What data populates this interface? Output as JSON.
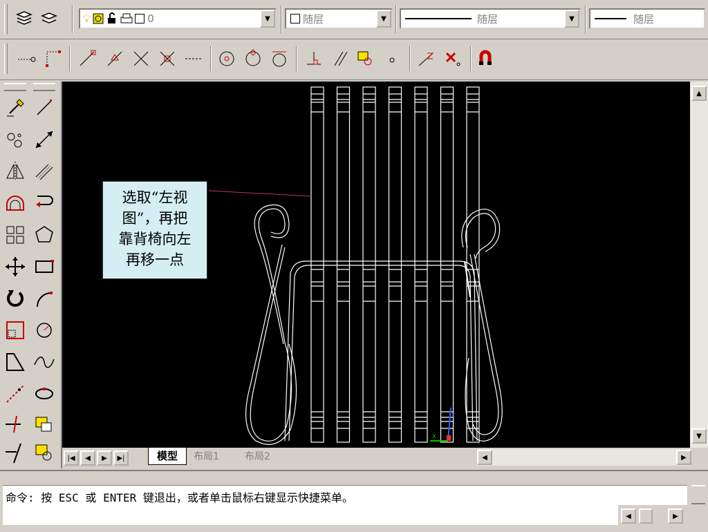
{
  "layer_bar": {
    "layer_value": "0",
    "color_value": "随层",
    "linetype_value": "随层",
    "lineweight_value": "随层"
  },
  "drawing": {
    "annotation_lines": [
      "选取“左视",
      "图”，再把",
      "靠背椅向左",
      "再移一点"
    ]
  },
  "tabs": {
    "model": "模型",
    "layout1": "布局1",
    "layout2": "布局2"
  },
  "command": {
    "line1": "命令: 按 ESC 或 ENTER 键退出，或者单击鼠标右键显示快捷菜单。",
    "line2": ""
  },
  "colors": {
    "canvas": "#000000",
    "drawing_stroke": "#ffffff",
    "leader": "#c03060",
    "note_bg": "#d4eef4"
  }
}
